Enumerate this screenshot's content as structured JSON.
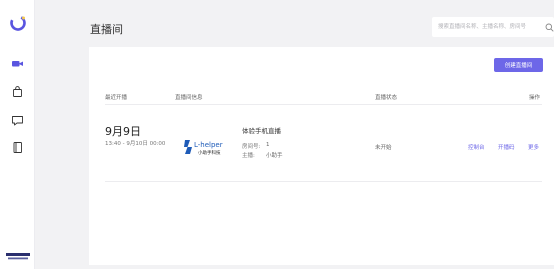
{
  "page": {
    "title": "直播间"
  },
  "search": {
    "placeholder": "搜索直播间名称、主播名称、房间号"
  },
  "toolbar": {
    "create_label": "创建直播间"
  },
  "table": {
    "headers": {
      "recent": "最近开播",
      "info": "直播间信息",
      "status": "直播状态",
      "actions": "操作"
    },
    "rows": [
      {
        "date": "9月9日",
        "range": "13:40 - 9月10日 00:00",
        "brand_name": "L-helper",
        "brand_sub": "小助手科技",
        "room_name": "体验手机直播",
        "room_no_label": "房间号:",
        "room_no": "1",
        "host_label": "主播:",
        "host": "小助手",
        "status": "未开始",
        "actions": [
          "控制台",
          "开播码",
          "更多"
        ]
      }
    ]
  },
  "colors": {
    "accent": "#6d67e8",
    "logo_accent": "#f5c84c"
  },
  "icons": {
    "logo": "app-logo-ring",
    "nav": [
      "video-camera-icon",
      "shopping-bag-icon",
      "message-icon",
      "book-icon"
    ],
    "search": "search-icon"
  }
}
